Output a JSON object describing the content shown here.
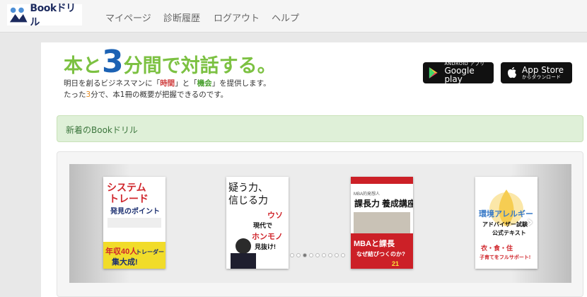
{
  "brand": {
    "name": "Bookドリル"
  },
  "nav": {
    "items": [
      {
        "label": "マイページ"
      },
      {
        "label": "診断履歴"
      },
      {
        "label": "ログアウト"
      },
      {
        "label": "ヘルプ"
      }
    ]
  },
  "hero": {
    "tagline": {
      "part1": "本と",
      "num": "3",
      "part2": "分間",
      "part3": "で対話する。"
    },
    "sub1": {
      "a": "明日を創るビジネスマンに「",
      "b": "時間",
      "c": "」と「",
      "d": "機会",
      "e": "」を提供します。"
    },
    "sub2": {
      "a": "たった",
      "b": "3",
      "c": "分で、本1冊の概要が把握できるのです。"
    }
  },
  "stores": {
    "google": {
      "small": "ANDROID アプリ",
      "big": "Google play"
    },
    "apple": {
      "big": "App Store",
      "small": "からダウンロード"
    }
  },
  "section": {
    "title": "新着のBookドリル"
  },
  "books": [
    {
      "title": "システムトレード 発見のポイント",
      "accent": "年収40人トレーダーの集大成!"
    },
    {
      "title": "疑う力、信じる力",
      "accent": "ウソだらけの現代でホンモノを見抜け!"
    },
    {
      "title": "課長力 養成講座",
      "accent": "MBAと課長はなぜ結びつくのか?"
    },
    {
      "title": "環境アレルギー アドバイザー試験 公式テキスト",
      "accent": "衣・食・住 子育てをフルサポート!"
    }
  ],
  "carousel": {
    "dot_count": 9,
    "active_dot": 2
  },
  "colors": {
    "green": "#7cc142",
    "blue": "#1c62b4",
    "panel_green": "#dff0d8"
  }
}
